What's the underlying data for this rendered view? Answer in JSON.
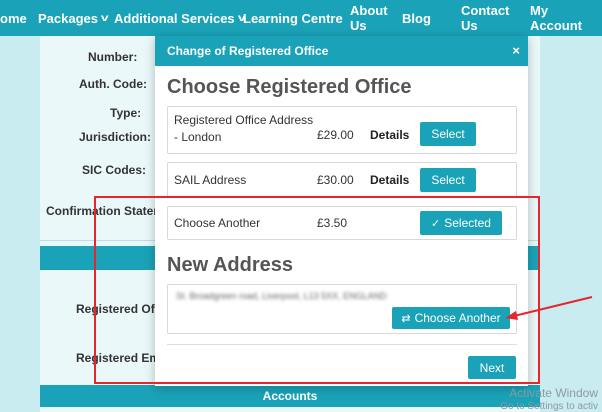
{
  "nav": {
    "items": [
      {
        "label": "ome",
        "chevron": false
      },
      {
        "label": "Packages",
        "chevron": true
      },
      {
        "label": "Additional Services",
        "chevron": true
      },
      {
        "label": "Learning Centre",
        "chevron": false
      },
      {
        "label": "About Us",
        "chevron": false
      },
      {
        "label": "Blog",
        "chevron": false
      },
      {
        "label": "Contact Us",
        "chevron": false
      },
      {
        "label": "My Account",
        "chevron": false
      }
    ]
  },
  "background": {
    "labels": {
      "number": "Number:",
      "auth_code": "Auth. Code:",
      "type": "Type:",
      "jurisdiction": "Jurisdiction:",
      "sic_codes": "SIC Codes:",
      "confirmation": "Confirmation Statem",
      "registered_office": "Registered Off",
      "registered_email": "Registered Em"
    },
    "accounts_band": "Accounts"
  },
  "modal": {
    "title": "Change of Registered Office",
    "close_glyph": "×",
    "choose_heading": "Choose Registered Office",
    "options": [
      {
        "name": "Registered Office Address - London",
        "price": "£29.00",
        "details": "Details",
        "button": "Select",
        "selected": false
      },
      {
        "name": "SAIL Address",
        "price": "£30.00",
        "details": "Details",
        "button": "Select",
        "selected": false
      },
      {
        "name": "Choose Another",
        "price": "£3.50",
        "details": "",
        "button": "Selected",
        "selected": true
      }
    ],
    "new_address_heading": "New Address",
    "new_address_value": "St. Broadgreen road, Liverpool, L13 5XX, ENGLAND",
    "choose_another_button": "Choose Another",
    "next_button": "Next"
  },
  "watermark": {
    "line1": "Activate Window",
    "line2": "Go to Settings to activ"
  },
  "colors": {
    "brand": "#1aa3b8",
    "annotation": "#e5262a"
  },
  "icons": {
    "check": "✓",
    "chevron": "⌄"
  }
}
